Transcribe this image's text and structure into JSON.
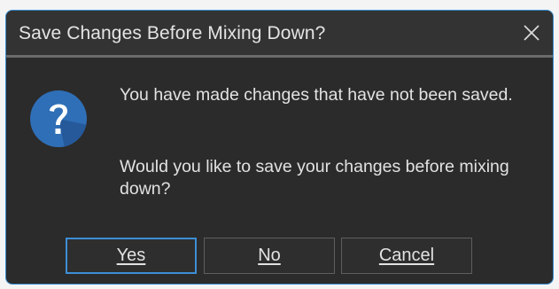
{
  "dialog": {
    "title": "Save Changes Before Mixing Down?",
    "close_icon": "close-icon",
    "question_icon": "question-mark-icon",
    "message_line1": "You have made changes that have not been saved.",
    "message_line2": "Would you like to save your changes before mixing down?",
    "buttons": {
      "yes": "Yes",
      "no": "No",
      "cancel": "Cancel"
    },
    "default_button": "yes"
  },
  "colors": {
    "background": "#2b2b2b",
    "titlebar": "#333333",
    "accent": "#3d8ed6",
    "text": "#e2e2e2",
    "icon_blue": "#2f6fb7"
  }
}
